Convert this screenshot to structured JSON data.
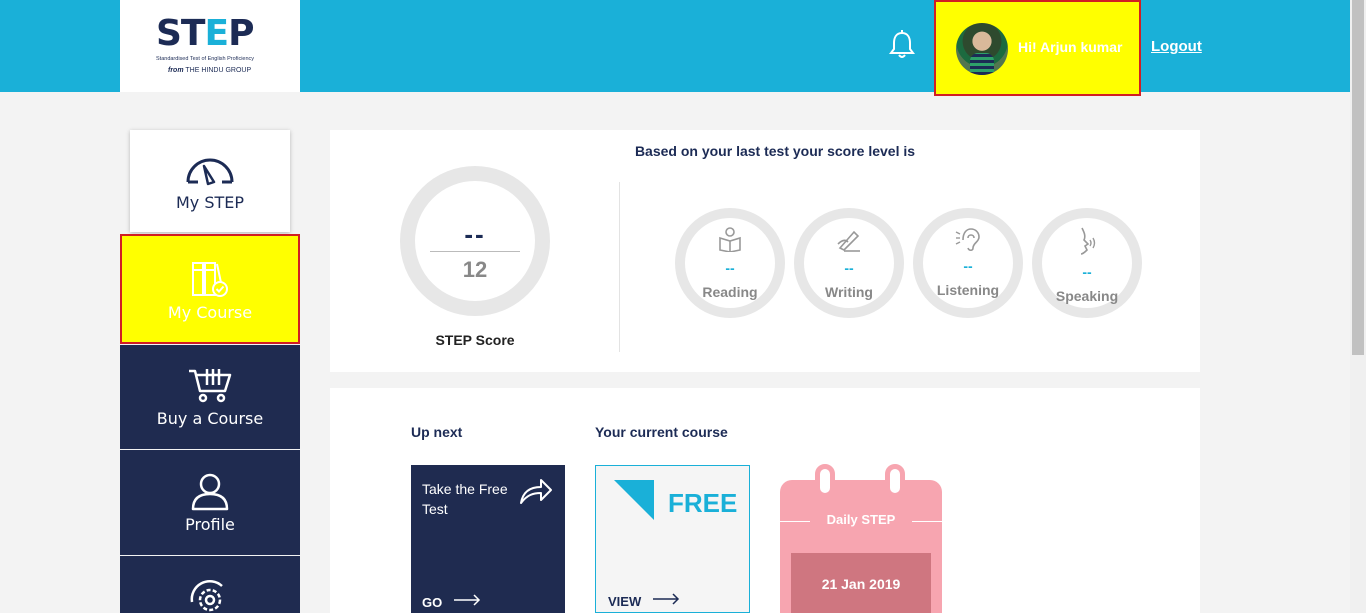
{
  "logo": {
    "wordmark_a": "ST",
    "wordmark_e": "E",
    "wordmark_b": "P",
    "tagline": "Standardised Test of English Proficiency",
    "from_label": "from",
    "from_group": "THE HINDU GROUP"
  },
  "header": {
    "greeting": "Hi! Arjun kumar",
    "logout": "Logout"
  },
  "sidebar": {
    "items": [
      {
        "label": "My STEP",
        "icon": "speedometer-icon"
      },
      {
        "label": "My Course",
        "icon": "books-check-icon"
      },
      {
        "label": "Buy a Course",
        "icon": "cart-icon"
      },
      {
        "label": "Profile",
        "icon": "user-icon"
      },
      {
        "label": "",
        "icon": "gear-icon"
      }
    ]
  },
  "score": {
    "title": "Based on your last test your score level is",
    "value": "--",
    "max": "12",
    "label": "STEP Score",
    "skills": [
      {
        "name": "Reading",
        "value": "--",
        "icon": "reading-icon"
      },
      {
        "name": "Writing",
        "value": "--",
        "icon": "writing-icon"
      },
      {
        "name": "Listening",
        "value": "--",
        "icon": "ear-icon"
      },
      {
        "name": "Speaking",
        "value": "--",
        "icon": "speaking-icon"
      }
    ]
  },
  "course": {
    "up_next": "Up next",
    "current_course": "Your current course",
    "next_tile": {
      "text": "Take the Free Test",
      "action": "GO"
    },
    "free_tile": {
      "badge": "FREE",
      "action": "VIEW"
    },
    "daily": {
      "title": "Daily STEP",
      "date": "21 Jan 2019"
    }
  },
  "colors": {
    "header": "#1ab0d8",
    "navy": "#1f2b50",
    "highlight": "#ffff00",
    "highlight_border": "#d11e24",
    "daily_pink": "#f7a5b0"
  }
}
